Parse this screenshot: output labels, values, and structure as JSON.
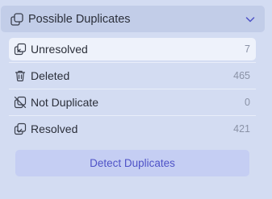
{
  "panel": {
    "title": "Possible Duplicates",
    "icon": "duplicate-icon",
    "expanded": true,
    "accent_color": "#4f53c7"
  },
  "filters": [
    {
      "label": "Unresolved",
      "count": "7",
      "icon": "unresolved-icon",
      "selected": true
    },
    {
      "label": "Deleted",
      "count": "465",
      "icon": "trash-icon",
      "selected": false
    },
    {
      "label": "Not Duplicate",
      "count": "0",
      "icon": "not-duplicate-icon",
      "selected": false
    },
    {
      "label": "Resolved",
      "count": "421",
      "icon": "resolved-icon",
      "selected": false
    }
  ],
  "actions": {
    "detect_label": "Detect Duplicates"
  }
}
